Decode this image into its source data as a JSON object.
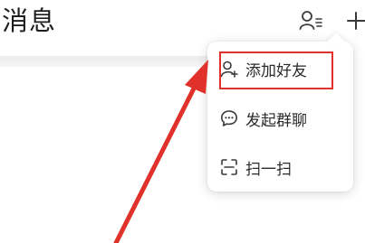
{
  "header": {
    "title": "消息",
    "icons": [
      "contacts-icon",
      "plus-icon"
    ]
  },
  "popup_menu": {
    "items": [
      {
        "label": "添加好友",
        "icon": "add-user-icon"
      },
      {
        "label": "发起群聊",
        "icon": "chat-bubble-icon"
      },
      {
        "label": "扫一扫",
        "icon": "scan-icon"
      }
    ]
  },
  "annotation": {
    "highlight_color": "#e0322b",
    "arrow_color": "#e0322b"
  }
}
